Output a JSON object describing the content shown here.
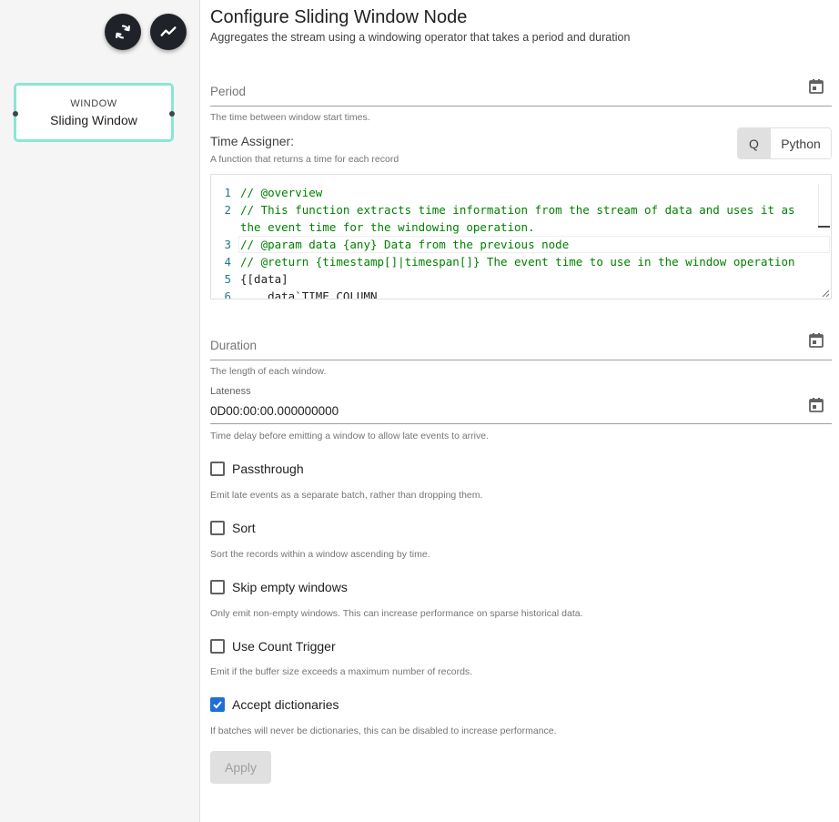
{
  "toolbar": {
    "refresh_icon": "refresh-icon",
    "chart_icon": "trend-line-icon"
  },
  "node": {
    "type": "WINDOW",
    "name": "Sliding Window",
    "border_color": "#8be6d4"
  },
  "header": {
    "title": "Configure Sliding Window Node",
    "subtitle": "Aggregates the stream using a windowing operator that takes a period and duration"
  },
  "period": {
    "label": "Period",
    "value": "",
    "helper": "The time between window start times.",
    "icon": "calendar-icon"
  },
  "time_assigner": {
    "label": "Time Assigner:",
    "helper": "A function that returns a time for each record",
    "languages": [
      "Q",
      "Python"
    ],
    "selected_language": "Q",
    "code_lines": [
      {
        "num": "1",
        "text": "// @overview"
      },
      {
        "num": "2",
        "text": "// This function extracts time information from the stream of data and uses it as"
      },
      {
        "num": "",
        "text": "the event time for the windowing operation."
      },
      {
        "num": "3",
        "text": "// @param data {any} Data from the previous node"
      },
      {
        "num": "4",
        "text": "// @return {timestamp[]|timespan[]} The event time to use in the window operation"
      },
      {
        "num": "5",
        "text": "{[data]"
      },
      {
        "num": "6",
        "text": "    data`TIME_COLUMN"
      }
    ]
  },
  "duration": {
    "label": "Duration",
    "value": "",
    "helper": "The length of each window.",
    "icon": "calendar-icon"
  },
  "lateness": {
    "label": "Lateness",
    "value": "0D00:00:00.000000000",
    "helper": "Time delay before emitting a window to allow late events to arrive.",
    "icon": "calendar-icon"
  },
  "options": [
    {
      "label": "Passthrough",
      "checked": false,
      "helper": "Emit late events as a separate batch, rather than dropping them."
    },
    {
      "label": "Sort",
      "checked": false,
      "helper": "Sort the records within a window ascending by time."
    },
    {
      "label": "Skip empty windows",
      "checked": false,
      "helper": "Only emit non-empty windows. This can increase performance on sparse historical data."
    },
    {
      "label": "Use Count Trigger",
      "checked": false,
      "helper": "Emit if the buffer size exceeds a maximum number of records."
    },
    {
      "label": "Accept dictionaries",
      "checked": true,
      "helper": "If batches will never be dictionaries, this can be disabled to increase performance."
    }
  ],
  "apply": {
    "label": "Apply",
    "enabled": false
  },
  "colors": {
    "accent": "#1e6fd9",
    "dark_button": "#1f2329",
    "comment": "#008000",
    "line_number": "#237893"
  }
}
